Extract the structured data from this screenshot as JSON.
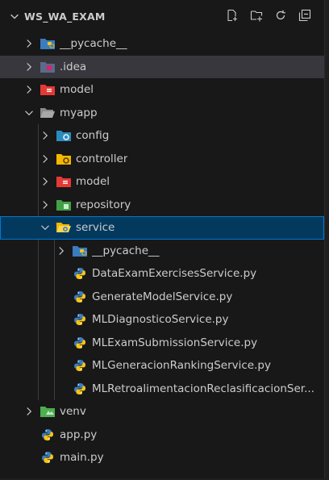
{
  "explorer": {
    "root_label": "WS_WA_EXAM",
    "actions": [
      "new-file-icon",
      "new-folder-icon",
      "refresh-icon",
      "collapse-all-icon"
    ]
  },
  "tree": {
    "pycache_root": "__pycache__",
    "idea": ".idea",
    "model_root": "model",
    "myapp": "myapp",
    "config": "config",
    "controller": "controller",
    "model": "model",
    "repository": "repository",
    "service": "service",
    "service_pycache": "__pycache__",
    "files_service": [
      "DataExamExercisesService.py",
      "GenerateModelService.py",
      "MLDiagnosticoService.py",
      "MLExamSubmissionService.py",
      "MLGeneracionRankingService.py",
      "MLRetroalimentacionReclasificacionSer..."
    ],
    "venv": "venv",
    "app": "app.py",
    "main": "main.py"
  },
  "colors": {
    "selection": "#04395e",
    "selection_border": "#0078d4",
    "hover": "#37373d",
    "python_blue": "#3b7bbf",
    "python_yellow": "#f5c518"
  }
}
